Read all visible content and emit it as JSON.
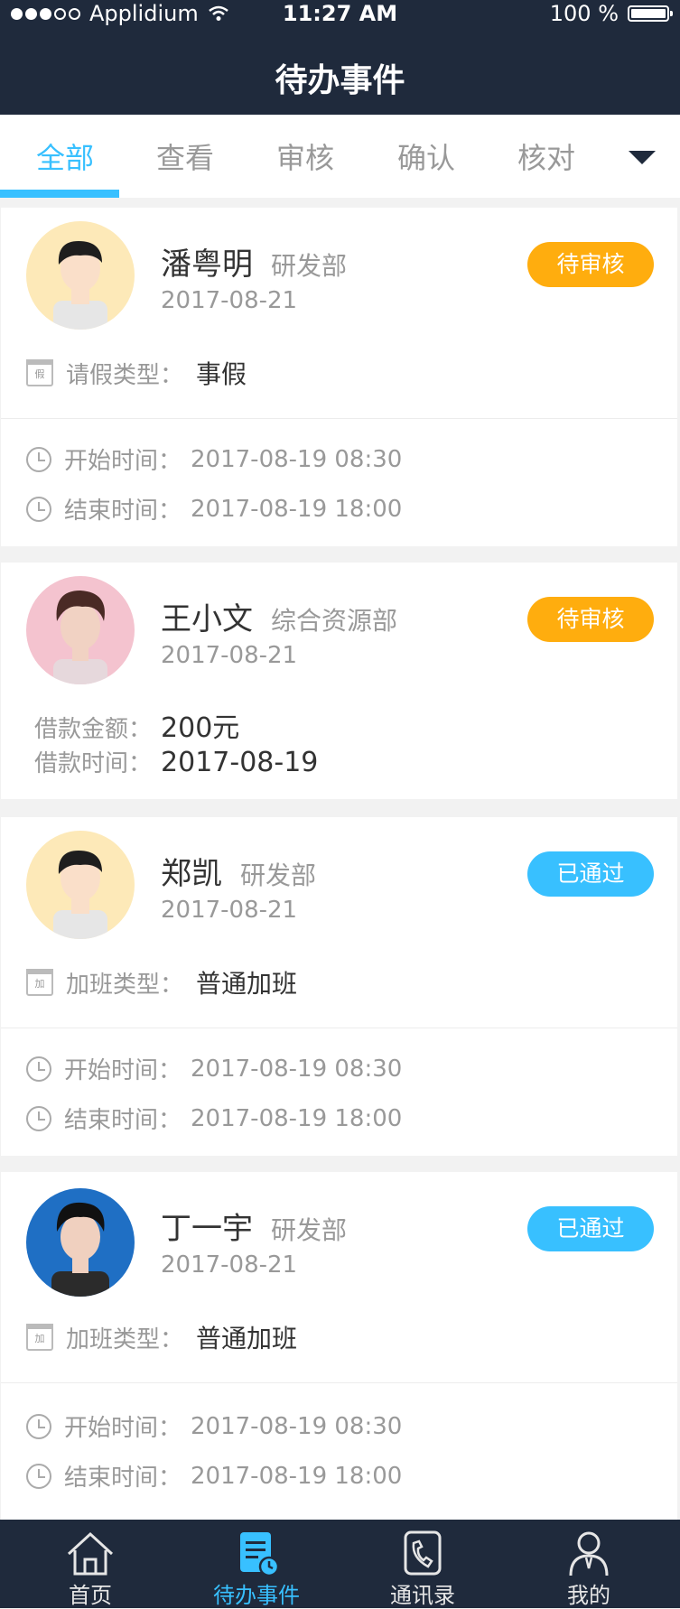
{
  "status_bar": {
    "carrier": "Applidium",
    "time": "11:27 AM",
    "battery": "100 %"
  },
  "nav": {
    "title": "待办事件"
  },
  "tabs": [
    {
      "label": "全部",
      "active": true
    },
    {
      "label": "查看",
      "active": false
    },
    {
      "label": "审核",
      "active": false
    },
    {
      "label": "确认",
      "active": false
    },
    {
      "label": "核对",
      "active": false
    }
  ],
  "cards": [
    {
      "name": "潘粤明",
      "dept": "研发部",
      "date": "2017-08-21",
      "status": "待审核",
      "status_type": "pending",
      "type_label": "请假类型：",
      "type_value": "事假",
      "type_icon": "假",
      "start_label": "开始时间：",
      "start_value": "2017-08-19  08:30",
      "end_label": "结束时间：",
      "end_value": "2017-08-19  18:00"
    },
    {
      "name": "王小文",
      "dept": "综合资源部",
      "date": "2017-08-21",
      "status": "待审核",
      "status_type": "pending",
      "amount_label": "借款金额：",
      "amount_value": "200元",
      "loan_time_label": "借款时间：",
      "loan_time_value": "2017-08-19"
    },
    {
      "name": "郑凯",
      "dept": "研发部",
      "date": "2017-08-21",
      "status": "已通过",
      "status_type": "passed",
      "type_label": "加班类型：",
      "type_value": "普通加班",
      "type_icon": "加",
      "start_label": "开始时间：",
      "start_value": "2017-08-19  08:30",
      "end_label": "结束时间：",
      "end_value": "2017-08-19  18:00"
    },
    {
      "name": "丁一宇",
      "dept": "研发部",
      "date": "2017-08-21",
      "status": "已通过",
      "status_type": "passed",
      "type_label": "加班类型：",
      "type_value": "普通加班",
      "type_icon": "加",
      "start_label": "开始时间：",
      "start_value": "2017-08-19  08:30",
      "end_label": "结束时间：",
      "end_value": "2017-08-19  18:00"
    }
  ],
  "tab_bar": [
    {
      "label": "首页",
      "icon": "home-icon"
    },
    {
      "label": "待办事件",
      "icon": "todo-icon"
    },
    {
      "label": "通讯录",
      "icon": "contacts-icon"
    },
    {
      "label": "我的",
      "icon": "profile-icon"
    }
  ],
  "colors": {
    "accent": "#38c0ff",
    "pending": "#ffad0e",
    "nav_bg": "#1f2a3c",
    "text_primary": "#333333",
    "text_secondary": "#999999"
  }
}
